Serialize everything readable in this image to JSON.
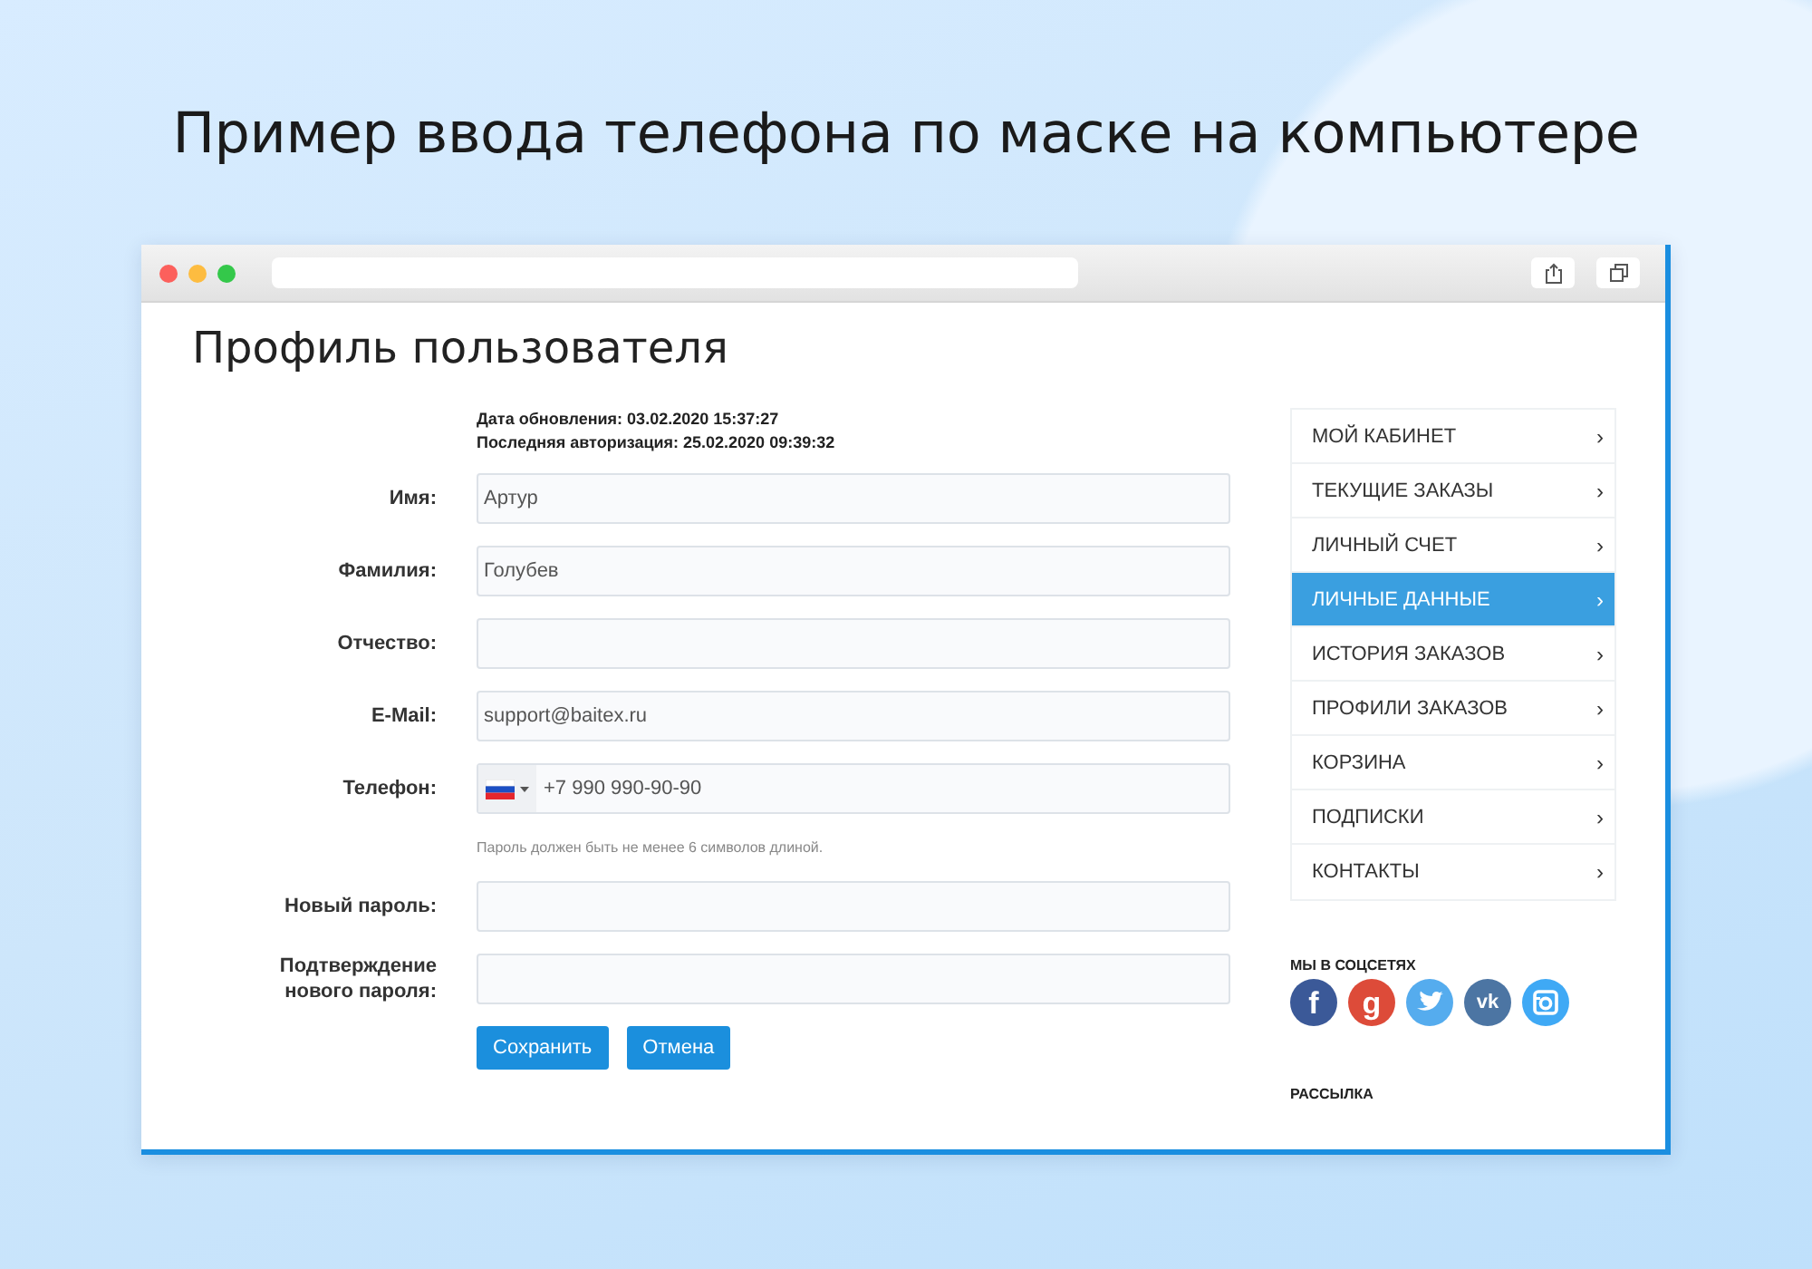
{
  "headline": "Пример ввода телефона по маске на компьютере",
  "page": {
    "title": "Профиль пользователя",
    "info": [
      "Дата обновления: 03.02.2020 15:37:27",
      "Последняя авторизация: 25.02.2020 09:39:32"
    ],
    "fields": [
      {
        "kind": "text",
        "label": "Имя:",
        "value": "Артур"
      },
      {
        "kind": "text",
        "label": "Фамилия:",
        "value": "Голубев"
      },
      {
        "kind": "text",
        "label": "Отчество:"
      },
      {
        "kind": "text",
        "label": "E-Mail:",
        "value": "support@baitex.ru"
      },
      {
        "kind": "phone",
        "label": "Телефон:",
        "value": "+7 990 990-90-90"
      }
    ],
    "password_hint": "Пароль должен быть не менее 6 символов длиной.",
    "password_fields": [
      {
        "label": "Новый пароль:"
      },
      {
        "label": "Подтверждение нового пароля:"
      }
    ],
    "buttons": [
      "Сохранить",
      "Отмена"
    ]
  },
  "sidebar": {
    "items": [
      {
        "label": "МОЙ КАБИНЕТ",
        "selected": false
      },
      {
        "label": "ТЕКУЩИЕ ЗАКАЗЫ",
        "selected": false
      },
      {
        "label": "ЛИЧНЫЙ СЧЕТ",
        "selected": false
      },
      {
        "label": "ЛИЧНЫЕ ДАННЫЕ",
        "selected": true
      },
      {
        "label": "ИСТОРИЯ ЗАКАЗОВ",
        "selected": false
      },
      {
        "label": "ПРОФИЛИ ЗАКАЗОВ",
        "selected": false
      },
      {
        "label": "КОРЗИНА",
        "selected": false
      },
      {
        "label": "ПОДПИСКИ",
        "selected": false
      },
      {
        "label": "КОНТАКТЫ",
        "selected": false
      }
    ],
    "chevron": "›",
    "social_title": "МЫ В СОЦСЕТЯХ",
    "social": [
      {
        "kind": "facebook",
        "glyph": "f",
        "color": "#3b5998"
      },
      {
        "kind": "google",
        "glyph": "g",
        "color": "#dd4b39"
      },
      {
        "kind": "twitter",
        "color": "#55acee"
      },
      {
        "kind": "vk",
        "glyph": "vk",
        "color": "#4c75a3"
      },
      {
        "kind": "instagram",
        "color": "#3fa9f5"
      }
    ],
    "newsletter_title": "РАССЫЛКА"
  }
}
